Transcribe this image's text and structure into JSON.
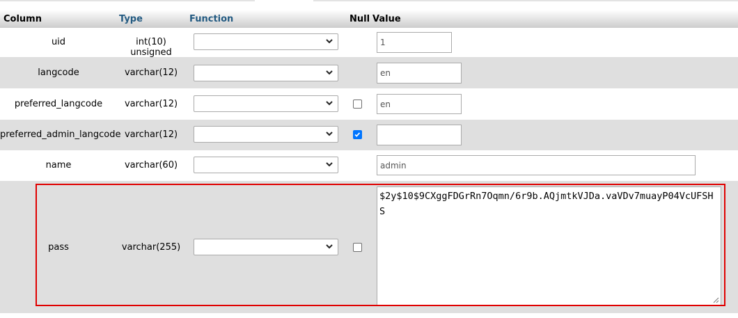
{
  "header": {
    "column": "Column",
    "type": "Type",
    "function": "Function",
    "null": "Null",
    "value": "Value"
  },
  "rows": [
    {
      "column": "uid",
      "type": "int(10) unsigned",
      "function": "",
      "has_null": false,
      "null_checked": false,
      "value": "1"
    },
    {
      "column": "langcode",
      "type": "varchar(12)",
      "function": "",
      "has_null": false,
      "null_checked": false,
      "value": "en"
    },
    {
      "column": "preferred_langcode",
      "type": "varchar(12)",
      "function": "",
      "has_null": true,
      "null_checked": false,
      "value": "en"
    },
    {
      "column": "preferred_admin_langcode",
      "type": "varchar(12)",
      "function": "",
      "has_null": true,
      "null_checked": true,
      "value": ""
    },
    {
      "column": "name",
      "type": "varchar(60)",
      "function": "",
      "has_null": false,
      "null_checked": false,
      "value": "admin"
    },
    {
      "column": "pass",
      "type": "varchar(255)",
      "function": "",
      "has_null": true,
      "null_checked": false,
      "value": "$2y$10$9CXggFDGrRn7Oqmn/6r9b.AQjmtkVJDa.vaVDv7muayP04VcUFSHS"
    }
  ],
  "colors": {
    "header_link": "#235a81",
    "alt_row": "#dfdfdf",
    "highlight": "#e00000",
    "checkbox_on": "#0075ff"
  }
}
